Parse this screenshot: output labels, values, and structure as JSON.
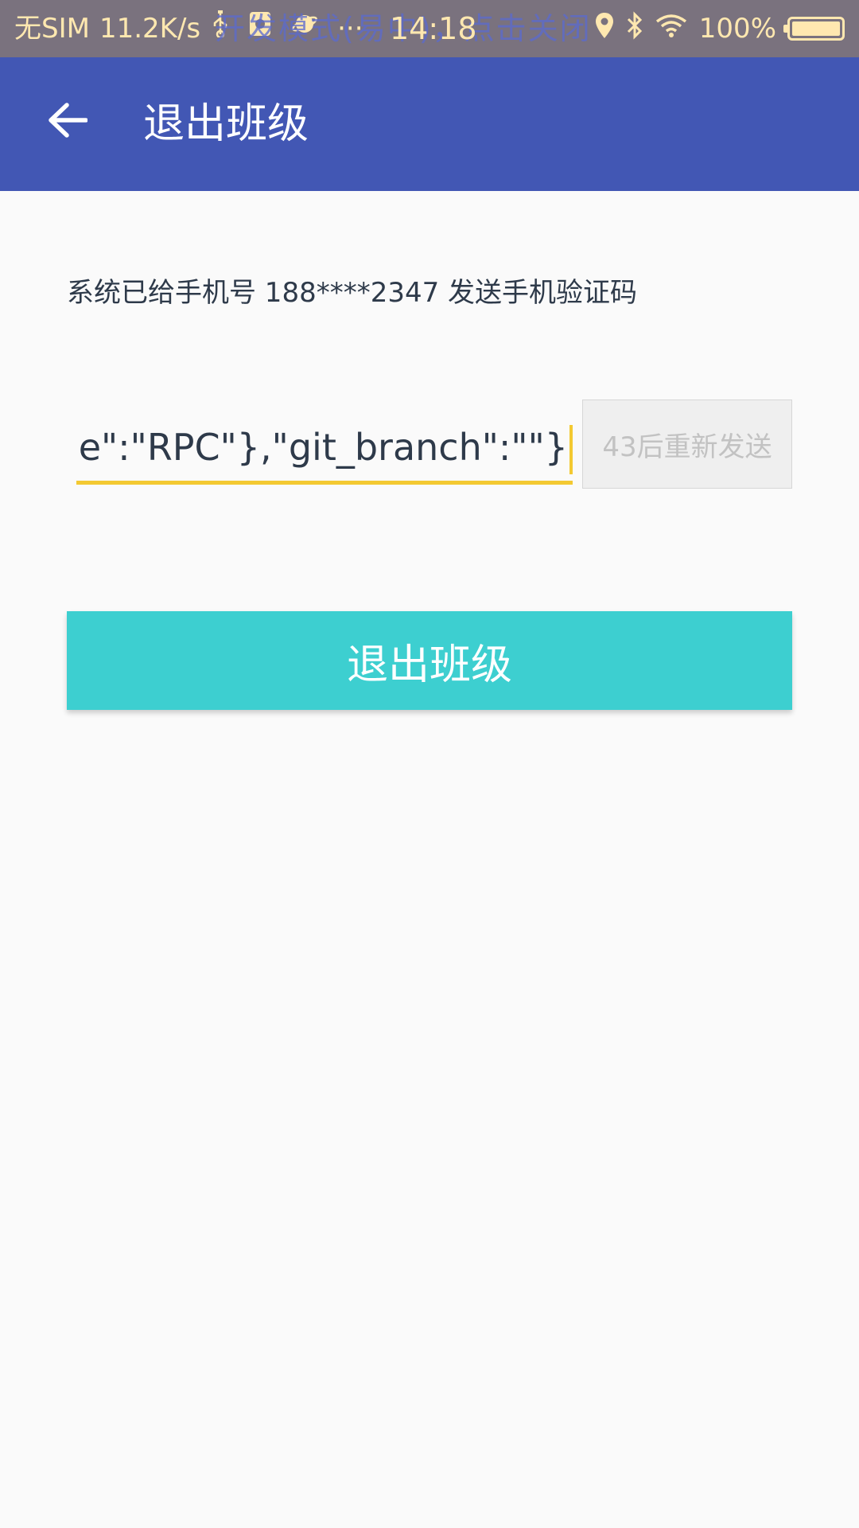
{
  "status_bar": {
    "carrier": "无SIM",
    "network_speed": "11.2K/s",
    "overlay_text": "开发模式(易中)，点击关闭",
    "time": "14:18",
    "battery": "100%",
    "more_dots": "···"
  },
  "app_bar": {
    "title": "退出班级"
  },
  "content": {
    "info_text": "系统已给手机号 188****2347 发送手机验证码",
    "code_input_value": "vice\":\"RPC\"},\"git_branch\":\"\"}",
    "resend_label": "43后重新发送",
    "exit_button_label": "退出班级"
  },
  "colors": {
    "app_bar": "#4257b4",
    "status_bar": "#7a727e",
    "accent_underline": "#f3c932",
    "exit_button": "#3dcfd0",
    "background": "#fafafa"
  }
}
